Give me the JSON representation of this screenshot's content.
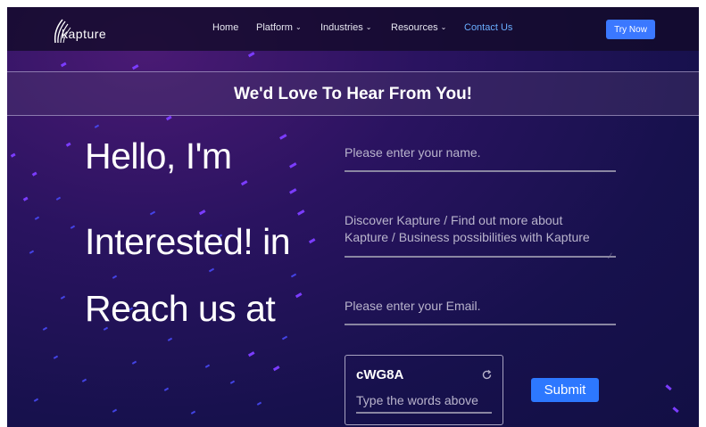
{
  "nav": {
    "logo_text": "kapture",
    "items": [
      {
        "label": "Home",
        "dropdown": false
      },
      {
        "label": "Platform",
        "dropdown": true
      },
      {
        "label": "Industries",
        "dropdown": true
      },
      {
        "label": "Resources",
        "dropdown": true
      },
      {
        "label": "Contact Us",
        "dropdown": false
      }
    ],
    "cta_label": "Try Now"
  },
  "banner": {
    "title": "We'd Love To Hear From You!"
  },
  "headlines": [
    "Hello, I'm",
    "Interested! in",
    "Reach us at"
  ],
  "form": {
    "name_placeholder": "Please enter your name.",
    "interest_line1": "Discover Kapture / Find out more about",
    "interest_line2": "Kapture / Business possibilities with Kapture",
    "email_placeholder": "Please enter your Email.",
    "captcha_code": "cWG8A",
    "captcha_placeholder": "Type the words above",
    "submit_label": "Submit"
  },
  "colors": {
    "accent": "#3b78ff",
    "active_nav": "#6aaeff",
    "confetti_purple": "#7b3cff",
    "confetti_blue": "#4a4cff",
    "background": "#1a124f"
  }
}
